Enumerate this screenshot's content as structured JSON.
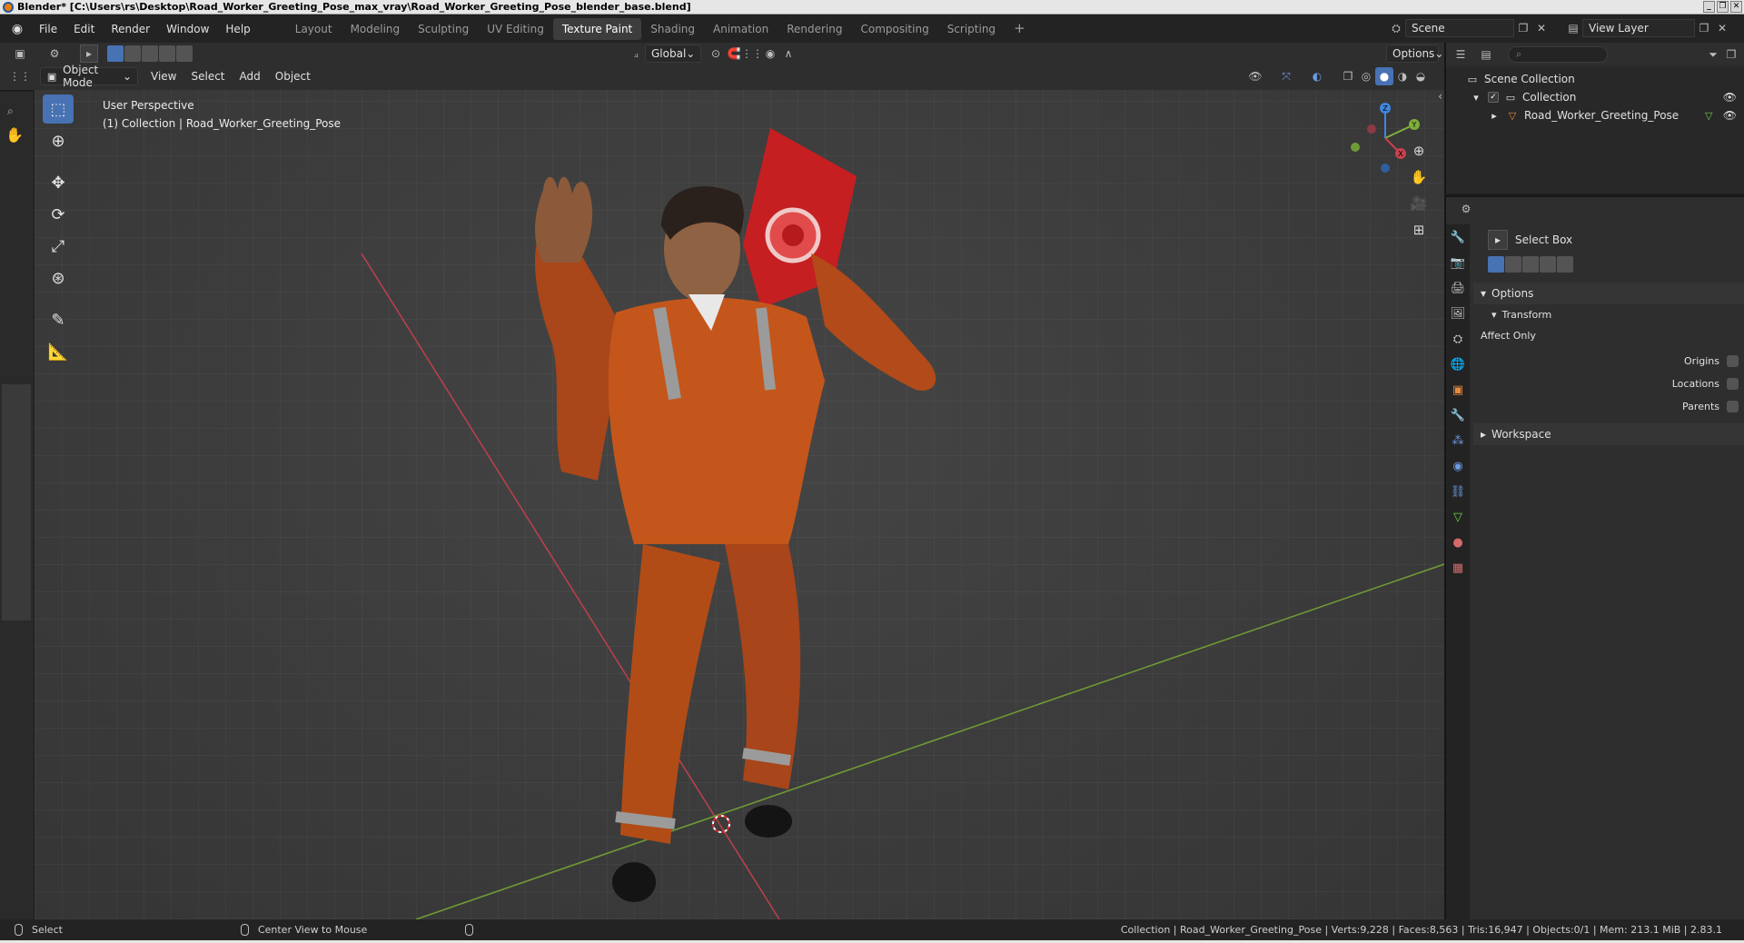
{
  "window": {
    "title": "Blender* [C:\\Users\\rs\\Desktop\\Road_Worker_Greeting_Pose_max_vray\\Road_Worker_Greeting_Pose_blender_base.blend]",
    "controls": [
      "_",
      "❐",
      "✕"
    ]
  },
  "menu": [
    "File",
    "Edit",
    "Render",
    "Window",
    "Help"
  ],
  "workspaces": [
    {
      "label": "Layout",
      "active": false
    },
    {
      "label": "Modeling",
      "active": false
    },
    {
      "label": "Sculpting",
      "active": false
    },
    {
      "label": "UV Editing",
      "active": false
    },
    {
      "label": "Texture Paint",
      "active": true
    },
    {
      "label": "Shading",
      "active": false
    },
    {
      "label": "Animation",
      "active": false
    },
    {
      "label": "Rendering",
      "active": false
    },
    {
      "label": "Compositing",
      "active": false
    },
    {
      "label": "Scripting",
      "active": false
    }
  ],
  "workspace_add": "+",
  "scene": "Scene",
  "view_layer": "View Layer",
  "viewport_header": {
    "transform_orientation": "Global",
    "options": "Options",
    "mode": "Object Mode",
    "menus": [
      "View",
      "Select",
      "Add",
      "Object"
    ]
  },
  "viewport": {
    "perspective": "User Perspective",
    "collection_line": "(1) Collection | Road_Worker_Greeting_Pose",
    "gizmo_axes": [
      "X",
      "Y",
      "Z"
    ]
  },
  "left_tools": [
    "select-box",
    "cursor",
    "move",
    "rotate",
    "scale",
    "transform",
    "annotate",
    "measure"
  ],
  "outliner": {
    "search_placeholder": "",
    "root": "Scene Collection",
    "collection": "Collection",
    "object": "Road_Worker_Greeting_Pose"
  },
  "properties": {
    "tool_name": "Select Box",
    "options_label": "Options",
    "transform_label": "Transform",
    "affect_only": "Affect Only",
    "origins": "Origins",
    "locations": "Locations",
    "parents": "Parents",
    "workspace_label": "Workspace"
  },
  "statusbar": {
    "select": "Select",
    "center_view": "Center View to Mouse",
    "stats": "Collection | Road_Worker_Greeting_Pose | Verts:9,228 | Faces:8,563 | Tris:16,947 | Objects:0/1 | Mem: 213.1 MiB | 2.83.1"
  },
  "colors": {
    "accent": "#4772b3",
    "suit": "#c4561b",
    "x_axis": "#c9414e",
    "y_axis": "#7fae3b",
    "z_axis": "#3f86e0"
  }
}
